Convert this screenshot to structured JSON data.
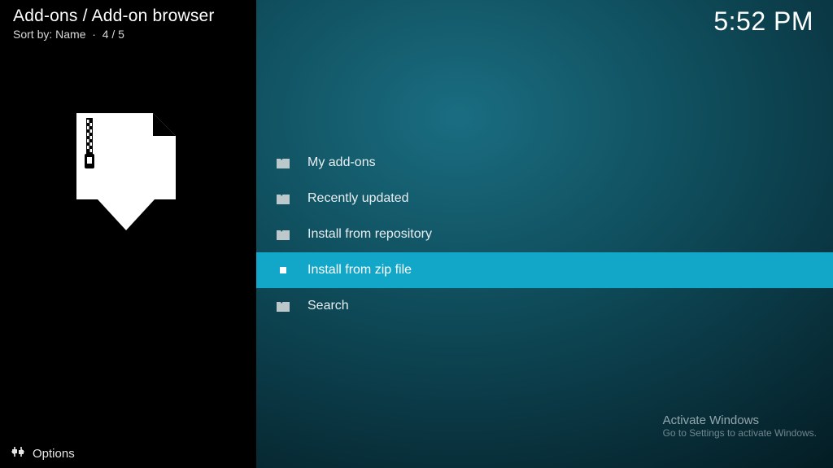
{
  "header": {
    "breadcrumb": "Add-ons / Add-on browser",
    "sort_label": "Sort by: Name",
    "position": "4 / 5"
  },
  "clock": "5:52 PM",
  "menu": {
    "items": [
      {
        "label": "My add-ons",
        "icon": "folder",
        "selected": false
      },
      {
        "label": "Recently updated",
        "icon": "folder",
        "selected": false
      },
      {
        "label": "Install from repository",
        "icon": "folder",
        "selected": false
      },
      {
        "label": "Install from zip file",
        "icon": "file",
        "selected": true
      },
      {
        "label": "Search",
        "icon": "folder",
        "selected": false
      }
    ]
  },
  "options_label": "Options",
  "watermark": {
    "title": "Activate Windows",
    "sub": "Go to Settings to activate Windows."
  }
}
